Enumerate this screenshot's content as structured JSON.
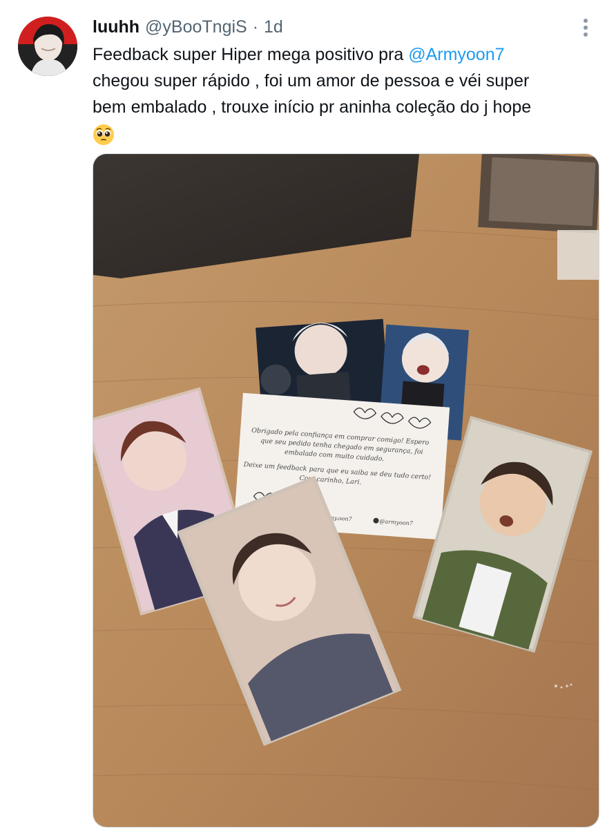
{
  "author": {
    "display_name": "luuhh",
    "handle": "@yBooTngiS",
    "separator": "·",
    "time": "1d"
  },
  "tweet": {
    "line1_prefix": "Feedback super Hiper mega positivo pra ",
    "mention": "@Armyoon7",
    "line2": "chegou super rápido , foi um amor de pessoa e véi super",
    "line3": "bem embalado , trouxe início pr aninha coleção do j hope",
    "emoji": "pleading-face-emoji"
  },
  "media": {
    "card_note": {
      "line1": "Obrigado pela confiança em comprar comigo! Espero",
      "line2": "que seu pedido tenha chegado em segurança, foi",
      "line3": "embalado com muito cuidado.",
      "line4": "Deixe um feedback para que eu saiba se deu tudo certo!",
      "line5": "Com carinho, Lari.",
      "handle_left": "@army.oon7",
      "handle_right": "@armyoon7"
    }
  },
  "icons": {
    "more": "more-vertical-icon"
  },
  "colors": {
    "link": "#1d9bf0",
    "secondary_text": "#536471",
    "primary_text": "#0f1419"
  }
}
